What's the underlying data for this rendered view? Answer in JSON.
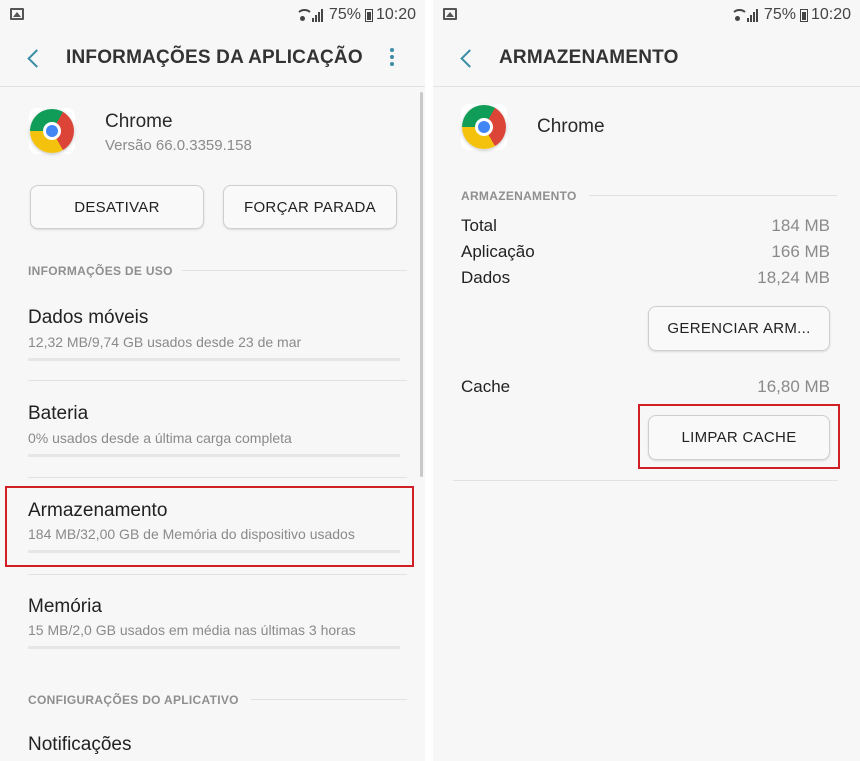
{
  "status_bar": {
    "battery": "75%",
    "time": "10:20"
  },
  "left": {
    "title": "INFORMAÇÕES DA APLICAÇÃO",
    "app": {
      "name": "Chrome",
      "version": "Versão 66.0.3359.158"
    },
    "buttons": {
      "disable": "DESATIVAR",
      "force_stop": "FORÇAR PARADA"
    },
    "usage_header": "INFORMAÇÕES DE USO",
    "items": [
      {
        "title": "Dados móveis",
        "subtitle": "12,32 MB/9,74 GB usados desde 23 de mar"
      },
      {
        "title": "Bateria",
        "subtitle": "0% usados desde a última carga completa"
      },
      {
        "title": "Armazenamento",
        "subtitle": "184 MB/32,00 GB de Memória do dispositivo usados"
      },
      {
        "title": "Memória",
        "subtitle": "15 MB/2,0 GB usados em média nas últimas 3 horas"
      }
    ],
    "config_header": "CONFIGURAÇÕES DO APLICATIVO",
    "notifications": "Notificações"
  },
  "right": {
    "title": "ARMAZENAMENTO",
    "app": {
      "name": "Chrome"
    },
    "storage_header": "ARMAZENAMENTO",
    "rows": [
      {
        "label": "Total",
        "value": "184 MB"
      },
      {
        "label": "Aplicação",
        "value": "166 MB"
      },
      {
        "label": "Dados",
        "value": "18,24 MB"
      }
    ],
    "manage_button": "GERENCIAR ARM...",
    "cache": {
      "label": "Cache",
      "value": "16,80 MB"
    },
    "clear_cache_button": "LIMPAR CACHE"
  },
  "colors": {
    "accent": "#3b8ea5",
    "highlight": "#d01f25"
  }
}
